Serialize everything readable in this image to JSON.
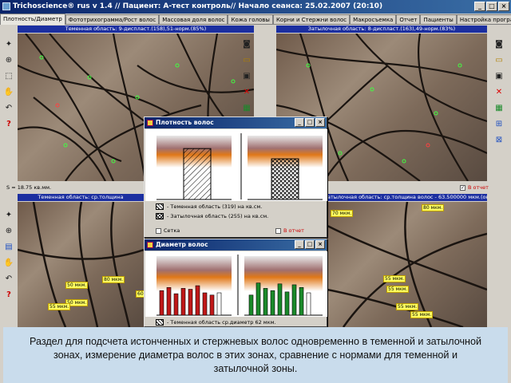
{
  "window": {
    "title": "Trichoscience® rus v 1.4 // Пациент: А-тест контроль// Начало сеанса: 25.02.2007 (20:10)",
    "min": "_",
    "max": "□",
    "close": "×"
  },
  "tabs": [
    "Плотность/Диаметр",
    "Фототрихограмма/Рост волос",
    "Массовая доля волос",
    "Кожа головы",
    "Корни и Стержни волос",
    "Макросъемка",
    "Отчет",
    "Пациенты",
    "Настройка программы"
  ],
  "panels": {
    "top_left_header": "Теменная область: 9-диспласт.(158),51-норм.(85%)",
    "top_right_header": "Затылочная область: 8-диспласт.(163),49-норм.(83%)",
    "bottom_left_header": "Теменная область: ср.толщина",
    "bottom_right_header": "атылочная область: ср.толщина волос - 63.500000 мкм.(окно-1)",
    "area_stat": "S = 18.75 кв.мм.",
    "report_check": "В отчет"
  },
  "density_dialog": {
    "title": "Плотность волос",
    "legend_1": "- Теменная область (319) на кв.см.",
    "legend_2": "- Затылочная область (255) на кв.см.",
    "grid_check": "Сетка",
    "report_check": "В отчет",
    "values": {
      "parietal": 319,
      "occipital": 255
    }
  },
  "diameter_dialog": {
    "title": "Диаметр волос",
    "legend_1": "- Теменная область ср.диаметр 62 мкм.",
    "parietal_bars": [
      0.55,
      0.62,
      0.48,
      0.6,
      0.58,
      0.66,
      0.5,
      0.45,
      0.5
    ],
    "occipital_bars": [
      0.45,
      0.72,
      0.6,
      0.55,
      0.7,
      0.52,
      0.68,
      0.62,
      0.5
    ]
  },
  "measure_labels": {
    "left": [
      "50 мкм.",
      "80 мкм.",
      "50 мкм.",
      "60",
      "55 мкм."
    ],
    "right": [
      "70 мкм.",
      "80 мкм.",
      "55 мкм.",
      "55 мкм.",
      "55 мкм.",
      "55 мкм."
    ]
  },
  "caption": "Раздел для подсчета истонченных и стержневых волос одновременно в теменной и затылочной зонах, измерение диаметра волос в этих зонах, сравнение с нормами для теменной и затылочной зоны.",
  "colors": {
    "title_blue": "#0a246a",
    "panel_blue": "#1c2fa0",
    "label_yellow": "#ffff60",
    "parietal_bar": "#c01818",
    "occipital_bar": "#1a8a2a",
    "band_orange": "#e07818"
  }
}
